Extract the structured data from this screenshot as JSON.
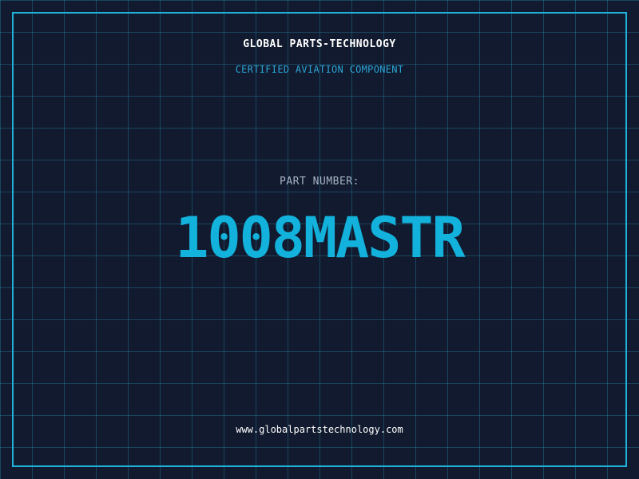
{
  "header": {
    "company": "GLOBAL PARTS-TECHNOLOGY",
    "tagline": "CERTIFIED AVIATION COMPONENT"
  },
  "part": {
    "label": "PART NUMBER:",
    "number": "1008MASTR"
  },
  "footer": {
    "website": "www.globalpartstechnology.com"
  },
  "colors": {
    "background": "#111a2e",
    "accent": "#12b2dc",
    "frame": "#1fb1d9",
    "grid": "#268caa"
  }
}
